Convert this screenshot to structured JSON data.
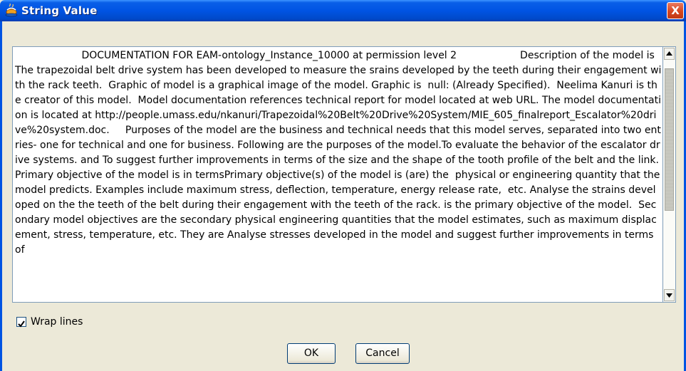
{
  "window": {
    "title": "String Value",
    "close_label": "X"
  },
  "icons": {
    "app": "java-cup-icon",
    "close": "close-icon",
    "scroll_up": "arrow-up-icon",
    "scroll_down": "arrow-down-icon",
    "check": "check-icon"
  },
  "text_value": "                     DOCUMENTATION FOR EAM-ontology_Instance_10000 at permission level 2                    Description of the model is The trapezoidal belt drive system has been developed to measure the srains developed by the teeth during their engagement with the rack teeth.  Graphic of model is a graphical image of the model. Graphic is  null: (Already Specified).  Neelima Kanuri is the creator of this model.  Model documentation references technical report for model located at web URL. The model documentation is located at http://people.umass.edu/nkanuri/Trapezoidal%20Belt%20Drive%20System/MIE_605_finalreport_Escalator%20drive%20system.doc.     Purposes of the model are the business and technical needs that this model serves, separated into two entries- one for technical and one for business. Following are the purposes of the model.To evaluate the behavior of the escalator drive systems. and To suggest further improvements in terms of the size and the shape of the tooth profile of the belt and the link.   Primary objective of the model is in termsPrimary objective(s) of the model is (are) the  physical or engineering quantity that the model predicts. Examples include maximum stress, deflection, temperature, energy release rate,  etc. Analyse the strains developed on the the teeth of the belt during their engagement with the teeth of the rack. is the primary objective of the model.  Secondary model objectives are the secondary physical engineering quantities that the model estimates, such as maximum displacement, stress, temperature, etc. They are Analyse stresses developed in the model and suggest further improvements in terms of",
  "wrap_lines": {
    "label": "Wrap lines",
    "checked": true
  },
  "buttons": {
    "ok": "OK",
    "cancel": "Cancel"
  },
  "colors": {
    "title_bar": "#0054e3",
    "close_button": "#d6461f",
    "dialog_bg": "#ece9d8"
  }
}
